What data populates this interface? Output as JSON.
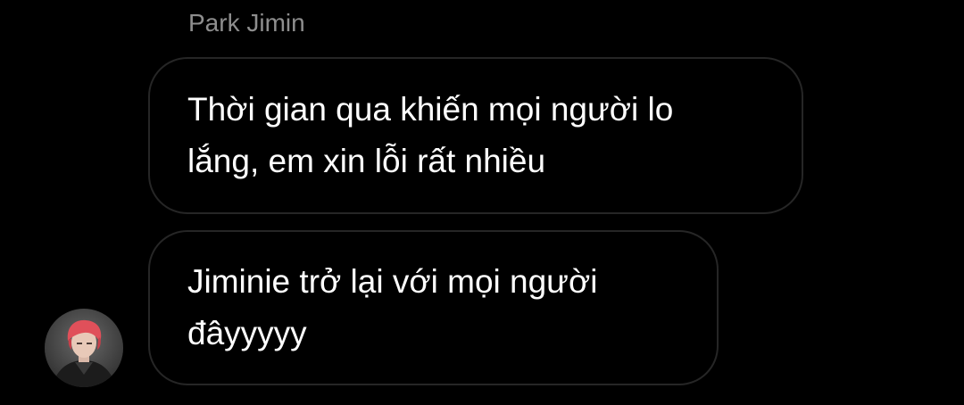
{
  "thread": {
    "sender_name": "Park Jimin",
    "messages": [
      {
        "text": "Thời gian qua khiến mọi người lo\nlắng, em xin lỗi rất nhiều"
      },
      {
        "text": "Jiminie trở lại với mọi người\nđâyyyyy"
      }
    ]
  },
  "avatar": {
    "icon": "profile-photo",
    "hair_color": "#e0505a"
  },
  "colors": {
    "background": "#000000",
    "bubble_border": "#262626",
    "message_text": "#ffffff",
    "sender_name": "#8e8e8e"
  }
}
